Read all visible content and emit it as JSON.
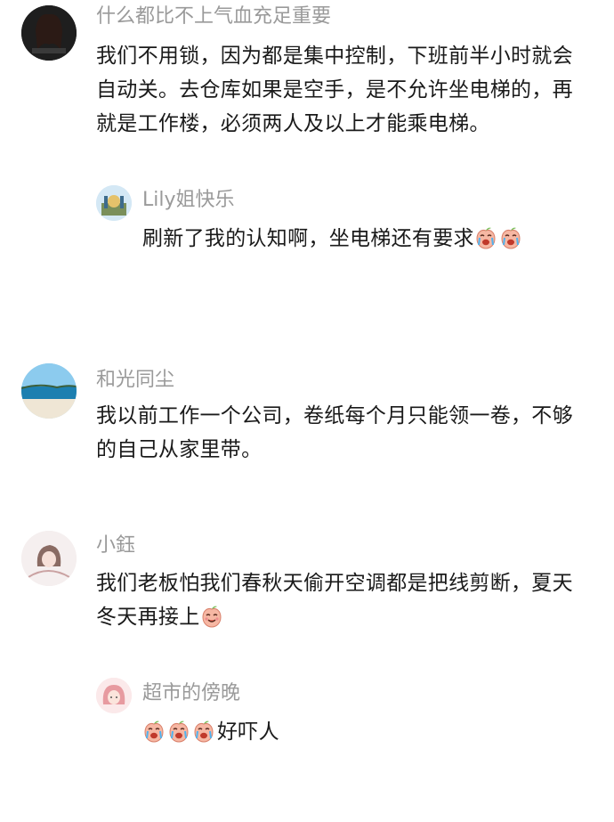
{
  "comments": [
    {
      "user": "什么都比不上气血充足重要",
      "lines": [
        "我们不用锁，因为都是集中控制，下班前半小时就会",
        "自动关。去仓库如果是空手，是不允许坐电梯的，再",
        "就是工作楼，必须两人及以上才能乘电梯。"
      ]
    },
    {
      "user": "Lily姐快乐",
      "text": "刷新了我的认知啊，坐电梯还有要求"
    },
    {
      "user": "和光同尘",
      "lines": [
        "我以前工作一个公司，卷纸每个月只能领一卷，不够",
        "的自己从家里带。"
      ]
    },
    {
      "user": "小鈺",
      "lines": [
        "我们老板怕我们春秋天偷开空调都是把线剪断，夏天",
        "冬天再接上"
      ]
    },
    {
      "user": "超市的傍晚",
      "text": "好吓人"
    }
  ],
  "icons": {
    "emoji_crying": "crying-peach-emoji",
    "emoji_smile": "smile-peach-emoji"
  },
  "colors": {
    "name_gray": "#9a9a9a",
    "text_dark": "#1a1a1a",
    "emoji_fill": "#f6b7a3"
  }
}
